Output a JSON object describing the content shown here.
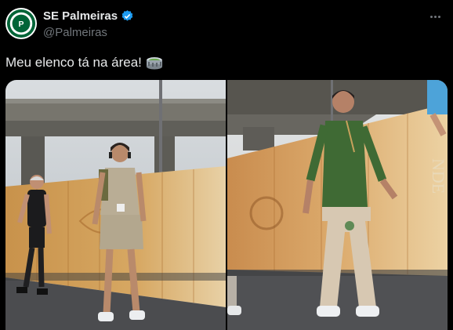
{
  "account": {
    "display_name": "SE Palmeiras",
    "handle": "@Palmeiras",
    "avatar_icon": "palmeiras-crest-icon",
    "verified_icon": "verified-badge-icon",
    "brand_color": "#006437",
    "verified_color": "#1d9bf0"
  },
  "tweet": {
    "text": "Meu elenco tá na área!",
    "emoji_icon": "stadium-emoji-icon"
  },
  "menu": {
    "icon": "more-options-icon"
  },
  "media": {
    "photos": [
      {
        "description_icon": "photo-player-walking"
      },
      {
        "description_icon": "photo-coach-walking",
        "visible_text": "NDE"
      }
    ]
  },
  "colors": {
    "background": "#000000",
    "text_primary": "#e7e9ea",
    "text_secondary": "#71767b"
  }
}
